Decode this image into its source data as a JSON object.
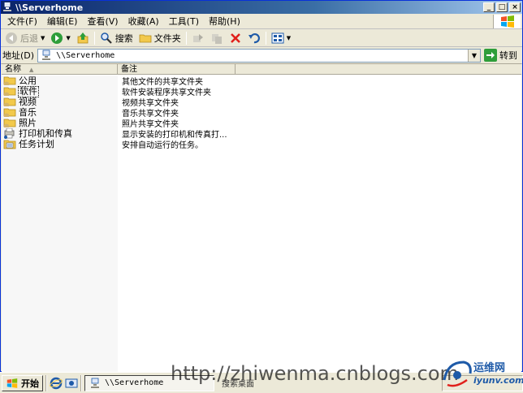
{
  "window": {
    "title": "\\\\Serverhome",
    "controls": {
      "minimize": "_",
      "restore": "□",
      "close": "×"
    }
  },
  "menubar": {
    "items": [
      {
        "label": "文件(F)"
      },
      {
        "label": "编辑(E)"
      },
      {
        "label": "查看(V)"
      },
      {
        "label": "收藏(A)"
      },
      {
        "label": "工具(T)"
      },
      {
        "label": "帮助(H)"
      }
    ]
  },
  "toolbar": {
    "back_label": "后退",
    "search_label": "搜索",
    "folders_label": "文件夹"
  },
  "addressbar": {
    "label": "地址(D)",
    "value": "\\\\Serverhome",
    "go_label": "转到"
  },
  "list": {
    "columns": [
      {
        "label": "名称"
      },
      {
        "label": "备注"
      }
    ],
    "rows": [
      {
        "name": "公用",
        "note": "其他文件的共享文件夹",
        "icon": "shared-folder-icon"
      },
      {
        "name": "软件",
        "note": "软件安装程序共享文件夹",
        "icon": "shared-folder-icon"
      },
      {
        "name": "视频",
        "note": "视频共享文件夹",
        "icon": "shared-folder-icon"
      },
      {
        "name": "音乐",
        "note": "音乐共享文件夹",
        "icon": "shared-folder-icon"
      },
      {
        "name": "照片",
        "note": "照片共享文件夹",
        "icon": "shared-folder-icon"
      },
      {
        "name": "打印机和传真",
        "note": "显示安装的打印机和传真打...",
        "icon": "printer-fax-folder-icon"
      },
      {
        "name": "任务计划",
        "note": "安排自动运行的任务。",
        "icon": "scheduled-tasks-folder-icon"
      }
    ]
  },
  "taskbar": {
    "start_label": "开始",
    "task_label": "\\\\Serverhome",
    "search_label": "搜索桌面"
  },
  "watermark": {
    "url": "http://zhiwenma.cnblogs.com",
    "logo_cn": "运维网",
    "logo_en": "iyunv.com"
  },
  "colors": {
    "titlebar": "#0a246a",
    "window_bg": "#ece9d8",
    "folder": "#f2c94c",
    "go_green": "#2e9e3a"
  }
}
